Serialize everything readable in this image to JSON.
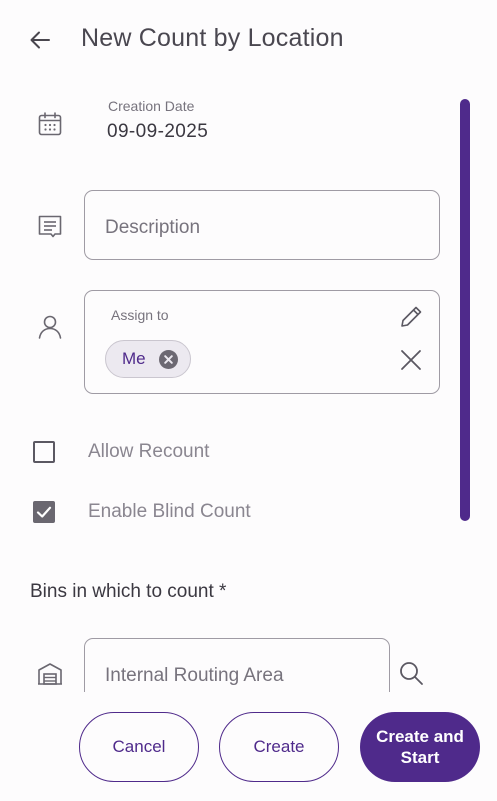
{
  "header": {
    "title": "New Count by Location",
    "back_icon": "arrow-left-icon"
  },
  "form": {
    "creation_date": {
      "label": "Creation Date",
      "value": "09-09-2025",
      "icon": "calendar-icon"
    },
    "description": {
      "placeholder": "Description",
      "value": "",
      "icon": "note-icon"
    },
    "assign_to": {
      "label": "Assign to",
      "chips": [
        "Me"
      ],
      "icon": "person-icon",
      "edit_icon": "pencil-icon",
      "clear_icon": "close-icon"
    },
    "allow_recount": {
      "label": "Allow Recount",
      "checked": false
    },
    "enable_blind_count": {
      "label": "Enable Blind Count",
      "checked": true
    },
    "bins_section": {
      "title": "Bins in which to count *",
      "field_placeholder": "Internal Routing Area",
      "icon": "warehouse-icon",
      "search_icon": "search-icon"
    }
  },
  "footer": {
    "cancel_label": "Cancel",
    "create_label": "Create",
    "create_start_label": "Create and Start"
  },
  "colors": {
    "accent": "#4f2a8b",
    "chip_bg": "#ece9f0",
    "background": "#fdfcfd"
  }
}
